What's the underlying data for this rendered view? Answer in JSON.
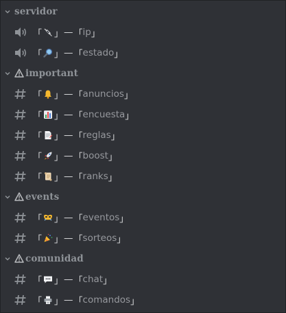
{
  "categories": [
    {
      "name": "servidor",
      "warn": false
    },
    {
      "name": "important",
      "warn": true
    },
    {
      "name": "events",
      "warn": true
    },
    {
      "name": "comunidad",
      "warn": true
    }
  ],
  "channels": {
    "ip": {
      "open": "「",
      "close": "」",
      "dash": "—",
      "name_open": "「",
      "name": "ip",
      "name_close": "」",
      "icon": "speaker-icon",
      "emoji": "syringe-emoji"
    },
    "estado": {
      "open": "「",
      "close": "」",
      "dash": "—",
      "name_open": "「",
      "name": "estado",
      "name_close": "」",
      "icon": "speaker-icon",
      "emoji": "magnifier-emoji"
    },
    "anuncios": {
      "open": "「",
      "close": "」",
      "dash": "—",
      "name_open": "「",
      "name": "anuncios",
      "name_close": "」",
      "icon": "hash-icon",
      "emoji": "bell-emoji"
    },
    "encuesta": {
      "open": "「",
      "close": "」",
      "dash": "—",
      "name_open": "「",
      "name": "encuesta",
      "name_close": "」",
      "icon": "hash-icon",
      "emoji": "bar-chart-emoji"
    },
    "reglas": {
      "open": "「",
      "close": "」",
      "dash": "—",
      "name_open": "「",
      "name": "reglas",
      "name_close": "」",
      "icon": "hash-icon",
      "emoji": "document-emoji"
    },
    "boost": {
      "open": "「",
      "close": "」",
      "dash": "—",
      "name_open": "「",
      "name": "boost",
      "name_close": "」",
      "icon": "hash-icon",
      "emoji": "rocket-emoji"
    },
    "ranks": {
      "open": "「",
      "close": "」",
      "dash": "—",
      "name_open": "「",
      "name": "ranks",
      "name_close": "」",
      "icon": "hash-icon",
      "emoji": "scroll-emoji"
    },
    "eventos": {
      "open": "「",
      "close": "」",
      "dash": "—",
      "name_open": "「",
      "name": "eventos",
      "name_close": "」",
      "icon": "hash-icon",
      "emoji": "mask-emoji"
    },
    "sorteos": {
      "open": "「",
      "close": "」",
      "dash": "—",
      "name_open": "「",
      "name": "sorteos",
      "name_close": "」",
      "icon": "hash-icon",
      "emoji": "party-popper-emoji"
    },
    "chat": {
      "open": "「",
      "close": "」",
      "dash": "—",
      "name_open": "「",
      "name": "chat",
      "name_close": "」",
      "icon": "hash-icon",
      "emoji": "speech-bubble-emoji"
    },
    "comandos": {
      "open": "「",
      "close": "」",
      "dash": "—",
      "name_open": "「",
      "name": "comandos",
      "name_close": "」",
      "icon": "hash-icon",
      "emoji": "printer-emoji"
    }
  },
  "colors": {
    "background": "#2f3136",
    "channel_text": "#8e9297",
    "category_text": "#8e9297",
    "bracket": "#dcddde"
  }
}
